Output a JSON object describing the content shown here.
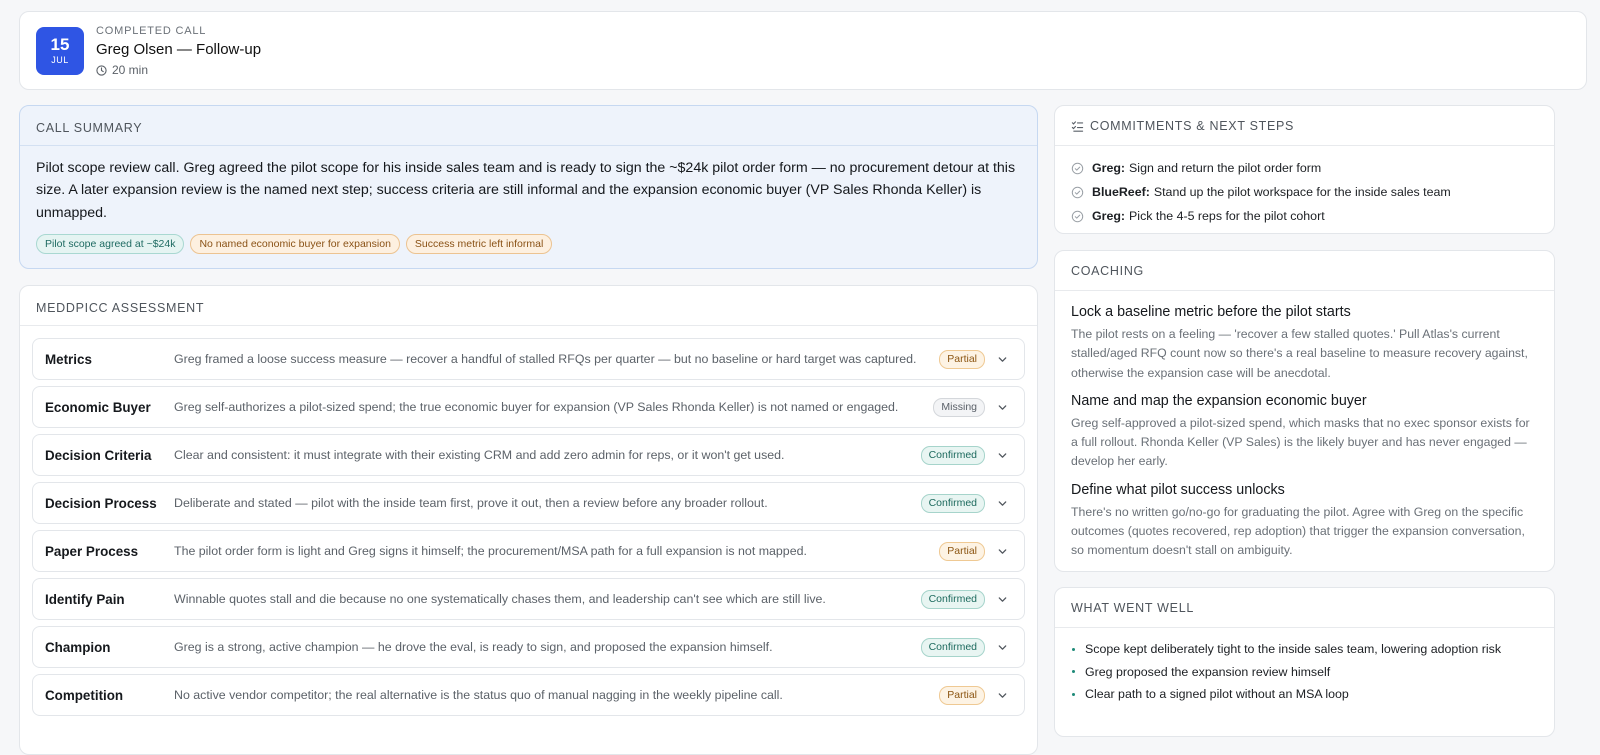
{
  "header": {
    "date_day": "15",
    "date_month": "JUL",
    "label": "COMPLETED CALL",
    "title": "Greg Olsen — Follow-up",
    "duration": "20 min"
  },
  "summary": {
    "title": "CALL SUMMARY",
    "text": "Pilot scope review call. Greg agreed the pilot scope for his inside sales team and is ready to sign the ~$24k pilot order form — no procurement detour at this size. A later expansion review is the named next step; success criteria are still informal and the expansion economic buyer (VP Sales Rhonda Keller) is unmapped.",
    "tags": [
      {
        "label": "Pilot scope agreed at ~$24k",
        "tone": "green"
      },
      {
        "label": "No named economic buyer for expansion",
        "tone": "orange"
      },
      {
        "label": "Success metric left informal",
        "tone": "orange"
      }
    ]
  },
  "meddpicc": {
    "title": "MEDDPICC ASSESSMENT",
    "rows": [
      {
        "name": "Metrics",
        "desc": "Greg framed a loose success measure — recover a handful of stalled RFQs per quarter — but no baseline or hard target was captured.",
        "status": "Partial"
      },
      {
        "name": "Economic Buyer",
        "desc": "Greg self-authorizes a pilot-sized spend; the true economic buyer for expansion (VP Sales Rhonda Keller) is not named or engaged.",
        "status": "Missing"
      },
      {
        "name": "Decision Criteria",
        "desc": "Clear and consistent: it must integrate with their existing CRM and add zero admin for reps, or it won't get used.",
        "status": "Confirmed"
      },
      {
        "name": "Decision Process",
        "desc": "Deliberate and stated — pilot with the inside team first, prove it out, then a review before any broader rollout.",
        "status": "Confirmed"
      },
      {
        "name": "Paper Process",
        "desc": "The pilot order form is light and Greg signs it himself; the procurement/MSA path for a full expansion is not mapped.",
        "status": "Partial"
      },
      {
        "name": "Identify Pain",
        "desc": "Winnable quotes stall and die because no one systematically chases them, and leadership can't see which are still live.",
        "status": "Confirmed"
      },
      {
        "name": "Champion",
        "desc": "Greg is a strong, active champion — he drove the eval, is ready to sign, and proposed the expansion himself.",
        "status": "Confirmed"
      },
      {
        "name": "Competition",
        "desc": "No active vendor competitor; the real alternative is the status quo of manual nagging in the weekly pipeline call.",
        "status": "Partial"
      }
    ]
  },
  "commitments": {
    "title": "COMMITMENTS & NEXT STEPS",
    "items": [
      {
        "who": "Greg:",
        "what": "Sign and return the pilot order form"
      },
      {
        "who": "BlueReef:",
        "what": "Stand up the pilot workspace for the inside sales team"
      },
      {
        "who": "Greg:",
        "what": "Pick the 4-5 reps for the pilot cohort"
      }
    ]
  },
  "coaching": {
    "title": "COACHING",
    "items": [
      {
        "title": "Lock a baseline metric before the pilot starts",
        "text": "The pilot rests on a feeling — 'recover a few stalled quotes.' Pull Atlas's current stalled/aged RFQ count now so there's a real baseline to measure recovery against, otherwise the expansion case will be anecdotal."
      },
      {
        "title": "Name and map the expansion economic buyer",
        "text": "Greg self-approved a pilot-sized spend, which masks that no exec sponsor exists for a full rollout. Rhonda Keller (VP Sales) is the likely buyer and has never engaged — develop her early."
      },
      {
        "title": "Define what pilot success unlocks",
        "text": "There's no written go/no-go for graduating the pilot. Agree with Greg on the specific outcomes (quotes recovered, rep adoption) that trigger the expansion conversation, so momentum doesn't stall on ambiguity."
      }
    ]
  },
  "went_well": {
    "title": "WHAT WENT WELL",
    "items": [
      "Scope kept deliberately tight to the inside sales team, lowering adoption risk",
      "Greg proposed the expansion review himself",
      "Clear path to a signed pilot without an MSA loop"
    ]
  },
  "colors": {
    "accent": "#2f55e4",
    "confirmed": "#1d6a5e",
    "partial": "#8c5613",
    "missing": "#5a6068"
  }
}
